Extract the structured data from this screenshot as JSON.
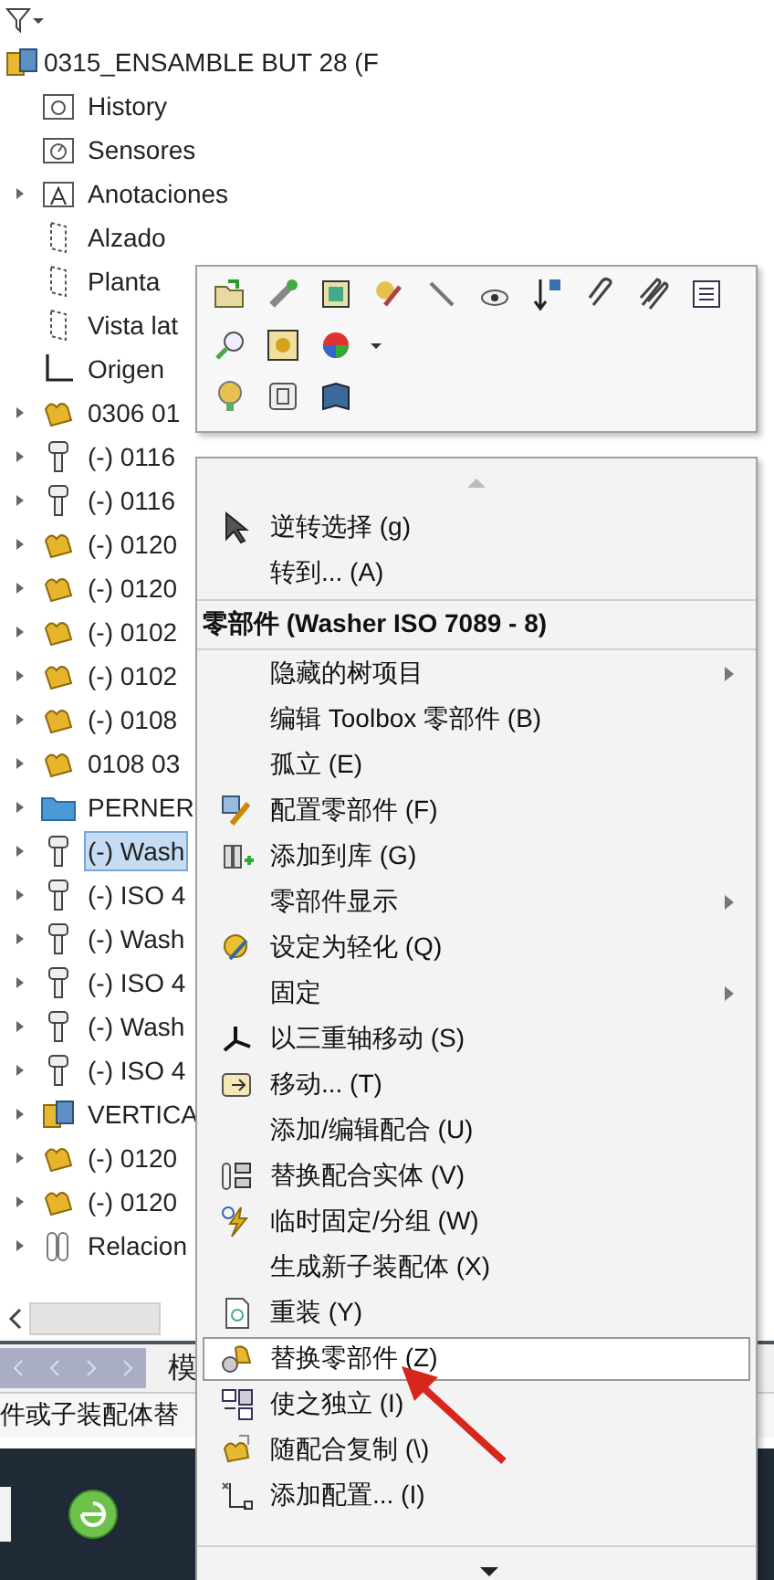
{
  "tree": {
    "label": "0315_ENSAMBLE BUT 28  (F",
    "kind": "assembly",
    "children": [
      {
        "label": "History",
        "kind": "history",
        "expandable": false,
        "selected": false
      },
      {
        "label": "Sensores",
        "kind": "sensor",
        "expandable": false,
        "selected": false
      },
      {
        "label": "Anotaciones",
        "kind": "annotation",
        "expandable": true,
        "selected": false
      },
      {
        "label": "Alzado",
        "kind": "plane",
        "expandable": false,
        "selected": false
      },
      {
        "label": "Planta",
        "kind": "plane",
        "expandable": false,
        "selected": false
      },
      {
        "label": "Vista lat",
        "kind": "plane",
        "expandable": false,
        "selected": false
      },
      {
        "label": "Origen",
        "kind": "origin",
        "expandable": false,
        "selected": false
      },
      {
        "label": "0306 01",
        "kind": "part",
        "expandable": true,
        "selected": false
      },
      {
        "label": "(-) 0116",
        "kind": "bolt",
        "expandable": true,
        "selected": false
      },
      {
        "label": "(-) 0116",
        "kind": "bolt",
        "expandable": true,
        "selected": false
      },
      {
        "label": "(-) 0120",
        "kind": "part",
        "expandable": true,
        "selected": false
      },
      {
        "label": "(-) 0120",
        "kind": "part",
        "expandable": true,
        "selected": false
      },
      {
        "label": "(-) 0102",
        "kind": "part",
        "expandable": true,
        "selected": false
      },
      {
        "label": "(-) 0102",
        "kind": "part",
        "expandable": true,
        "selected": false
      },
      {
        "label": "(-) 0108",
        "kind": "part",
        "expandable": true,
        "selected": false
      },
      {
        "label": "0108 03",
        "kind": "part",
        "expandable": true,
        "selected": false
      },
      {
        "label": "PERNER",
        "kind": "folder",
        "expandable": true,
        "selected": false
      },
      {
        "label": "(-) Wash",
        "kind": "bolt",
        "expandable": true,
        "selected": true
      },
      {
        "label": "(-) ISO 4",
        "kind": "bolt",
        "expandable": true,
        "selected": false
      },
      {
        "label": "(-) Wash",
        "kind": "bolt",
        "expandable": true,
        "selected": false
      },
      {
        "label": "(-) ISO 4",
        "kind": "bolt",
        "expandable": true,
        "selected": false
      },
      {
        "label": "(-) Wash",
        "kind": "bolt",
        "expandable": true,
        "selected": false
      },
      {
        "label": "(-) ISO 4",
        "kind": "bolt",
        "expandable": true,
        "selected": false
      },
      {
        "label": "VERTICA",
        "kind": "assembly",
        "expandable": true,
        "selected": false
      },
      {
        "label": "(-) 0120",
        "kind": "part",
        "expandable": true,
        "selected": false
      },
      {
        "label": "(-) 0120",
        "kind": "part",
        "expandable": true,
        "selected": false
      },
      {
        "label": "Relacion",
        "kind": "mates",
        "expandable": true,
        "selected": false
      }
    ]
  },
  "bottom_tab": "模",
  "status_text": "件或子装配体替",
  "context_menu": {
    "items": [
      {
        "kind": "item",
        "label": "逆转选择 (g)",
        "icon": true,
        "submenu": false,
        "selected": false
      },
      {
        "kind": "item",
        "label": "转到... (A)",
        "icon": false,
        "submenu": false,
        "selected": false
      },
      {
        "kind": "separator"
      },
      {
        "kind": "header",
        "label": "零部件 (Washer ISO 7089 - 8)"
      },
      {
        "kind": "separator"
      },
      {
        "kind": "item",
        "label": "隐藏的树项目",
        "icon": false,
        "submenu": true,
        "selected": false
      },
      {
        "kind": "item",
        "label": "编辑 Toolbox 零部件 (B)",
        "icon": false,
        "submenu": false,
        "selected": false
      },
      {
        "kind": "item",
        "label": "孤立 (E)",
        "icon": false,
        "submenu": false,
        "selected": false
      },
      {
        "kind": "item",
        "label": "配置零部件 (F)",
        "icon": true,
        "submenu": false,
        "selected": false
      },
      {
        "kind": "item",
        "label": "添加到库 (G)",
        "icon": true,
        "submenu": false,
        "selected": false
      },
      {
        "kind": "item",
        "label": "零部件显示",
        "icon": false,
        "submenu": true,
        "selected": false
      },
      {
        "kind": "item",
        "label": "设定为轻化 (Q)",
        "icon": true,
        "submenu": false,
        "selected": false
      },
      {
        "kind": "item",
        "label": "固定",
        "icon": false,
        "submenu": true,
        "selected": false
      },
      {
        "kind": "item",
        "label": "以三重轴移动 (S)",
        "icon": true,
        "submenu": false,
        "selected": false
      },
      {
        "kind": "item",
        "label": "移动... (T)",
        "icon": true,
        "submenu": false,
        "selected": false
      },
      {
        "kind": "item",
        "label": "添加/编辑配合 (U)",
        "icon": false,
        "submenu": false,
        "selected": false
      },
      {
        "kind": "item",
        "label": "替换配合实体 (V)",
        "icon": true,
        "submenu": false,
        "selected": false
      },
      {
        "kind": "item",
        "label": "临时固定/分组 (W)",
        "icon": true,
        "submenu": false,
        "selected": false
      },
      {
        "kind": "item",
        "label": "生成新子装配体 (X)",
        "icon": false,
        "submenu": false,
        "selected": false
      },
      {
        "kind": "item",
        "label": "重装 (Y)",
        "icon": true,
        "submenu": false,
        "selected": false
      },
      {
        "kind": "item",
        "label": "替换零部件 (Z)",
        "icon": true,
        "submenu": false,
        "selected": true
      },
      {
        "kind": "item",
        "label": "使之独立 (I)",
        "icon": true,
        "submenu": false,
        "selected": false
      },
      {
        "kind": "item",
        "label": "随配合复制 (\\)",
        "icon": true,
        "submenu": false,
        "selected": false
      },
      {
        "kind": "item",
        "label": "添加配置... (I)",
        "icon": true,
        "submenu": false,
        "selected": false
      }
    ]
  }
}
